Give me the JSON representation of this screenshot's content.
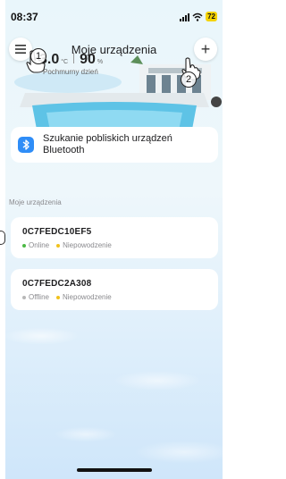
{
  "status_bar": {
    "time": "08:37",
    "battery": "72"
  },
  "header": {
    "title": "Moje urządzenia"
  },
  "weather": {
    "temperature": "3.0",
    "temperature_unit": "°C",
    "humidity": "90",
    "humidity_unit": "%",
    "description": "Pochmurny dzień"
  },
  "annotations": {
    "marker_1": "1",
    "marker_2": "2"
  },
  "bluetooth_card": {
    "label": "Szukanie pobliskich urządzeń Bluetooth",
    "icon": "bluetooth-icon"
  },
  "devices_section": {
    "label": "Moje urządzenia",
    "devices": [
      {
        "id": "0C7FEDC10EF5",
        "connection": "Online",
        "connection_color": "#4cb944",
        "state": "Niepowodzenie",
        "state_color": "#f1c21b"
      },
      {
        "id": "0C7FEDC2A308",
        "connection": "Offline",
        "connection_color": "#b8b8b8",
        "state": "Niepowodzenie",
        "state_color": "#f1c21b"
      }
    ]
  },
  "colors": {
    "accent": "#2f8df7",
    "background": "#e9f6fb"
  }
}
